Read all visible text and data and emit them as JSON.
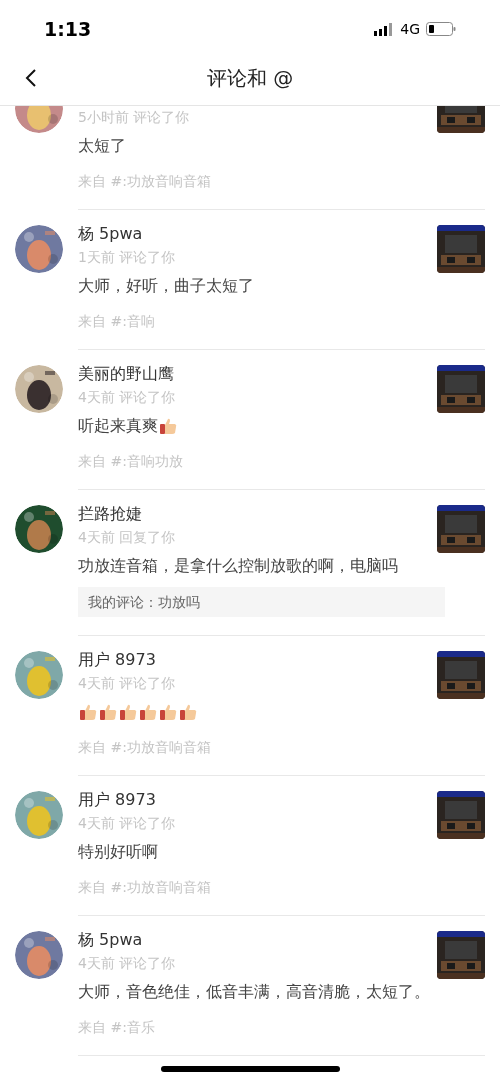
{
  "status_bar": {
    "time": "1:13",
    "network": "4G"
  },
  "header": {
    "title": "评论和 @"
  },
  "comments": [
    {
      "meta": "5小时前 评论了你",
      "body": "太短了",
      "source": "来自 #:功放音响音箱"
    },
    {
      "name": "杨 5pwa",
      "meta": "1天前 评论了你",
      "body": "大师，好听，曲子太短了",
      "source": "来自 #:音响"
    },
    {
      "name": "美丽的野山鹰",
      "meta": "4天前 评论了你",
      "body": "听起来真爽",
      "emojis": [
        {
          "kind": "thumbs-up"
        }
      ],
      "source": "来自 #:音响功放"
    },
    {
      "name": "拦路抢婕",
      "meta": "4天前 回复了你",
      "body": "功放连音箱，是拿什么控制放歌的啊，电脑吗",
      "my_comment": "我的评论：功放吗"
    },
    {
      "name": "用户 8973",
      "meta": "4天前 评论了你",
      "emojis": [
        {
          "kind": "thumbs-up"
        },
        {
          "kind": "thumbs-up"
        },
        {
          "kind": "thumbs-up"
        },
        {
          "kind": "thumbs-up"
        },
        {
          "kind": "thumbs-up"
        },
        {
          "kind": "thumbs-up"
        }
      ],
      "source": "来自 #:功放音响音箱"
    },
    {
      "name": "用户 8973",
      "meta": "4天前 评论了你",
      "body": "特别好听啊",
      "source": "来自 #:功放音响音箱"
    },
    {
      "name": "杨 5pwa",
      "meta": "4天前 评论了你",
      "body": "大师，音色绝佳，低音丰满，高音清脆，太短了。",
      "source": "来自 #:音乐"
    }
  ]
}
